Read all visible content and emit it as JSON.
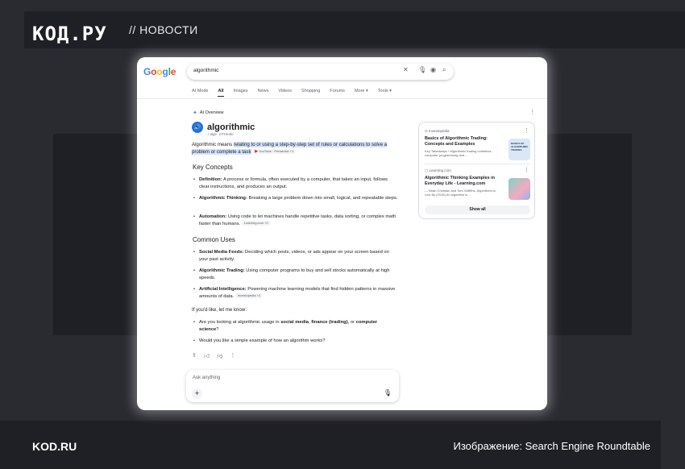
{
  "brand": {
    "logo": "КОД.РУ",
    "section": "// НОВОСТИ"
  },
  "footer": {
    "site": "KOD.RU",
    "credit": "Изображение: Search Engine Roundtable"
  },
  "google": {
    "logo": [
      "G",
      "o",
      "o",
      "g",
      "l",
      "e"
    ],
    "query": "algorithmic",
    "tabs": [
      "AI Mode",
      "All",
      "Images",
      "News",
      "Videos",
      "Shopping",
      "Forums",
      "More ▾",
      "Tools ▾"
    ],
    "active_tab": "All",
    "ai_overview_label": "AI Overview",
    "term": "algorithmic",
    "pronunciation": "/ alge ˈrɪTHmɪk/",
    "definition_prefix": "Algorithmic means ",
    "definition_highlight": "relating to or using a step-by-step set of rules or calculations to solve a problem or complete a task",
    "definition_source": "YouTube · Periwinkle +1",
    "key_concepts_heading": "Key Concepts",
    "key_concepts": [
      {
        "term": "Definition:",
        "text": " A process or formula, often executed by a computer, that takes an input, follows clear instructions, and produces an output."
      },
      {
        "term": "Algorithmic Thinking:",
        "text": " Breaking a large problem down into small, logical, and repeatable steps."
      },
      {
        "term": "Automation:",
        "text": " Using code to let machines handle repetitive tasks, data sorting, or complex math faster than humans.",
        "source": "Learning.com +2"
      }
    ],
    "common_uses_heading": "Common Uses",
    "common_uses": [
      {
        "term": "Social Media Feeds:",
        "text": " Deciding which posts, videos, or ads appear on your screen based on your past activity."
      },
      {
        "term": "Algorithmic Trading:",
        "text": " Using computer programs to buy and sell stocks automatically at high speeds."
      },
      {
        "term": "Artificial Intelligence:",
        "text": " Powering machine learning models that find hidden patterns in massive amounts of data.",
        "source": "Investopedia +2"
      }
    ],
    "followup_intro": "If you'd like, let me know:",
    "followups": [
      {
        "prefix": "Are you looking at algorithmic usage in ",
        "b1": "social media",
        "mid1": ", ",
        "b2": "finance (trading)",
        "mid2": ", or ",
        "b3": "computer science",
        "suffix": "?"
      },
      {
        "text": "Would you like a simple example of how an algorithm works?"
      }
    ],
    "ask_placeholder": "Ask anything",
    "sources": [
      {
        "site": "Investopedia",
        "title": "Basics of Algorithmic Trading: Concepts and Examples",
        "snippet": "Key Takeaways * Algorithmic trading combines computer programming and ...",
        "thumb_text": "BASICS OF ALGORITHMIC TRADING"
      },
      {
        "site": "Learning.com",
        "title": "Algorithmic Thinking Examples in Everyday Life - Learning.com",
        "snippet": "— Brian Christian and Tom Griffiths, Algorithms to Live By (2016) An algorithm is ..."
      }
    ],
    "show_all": "Show all"
  }
}
